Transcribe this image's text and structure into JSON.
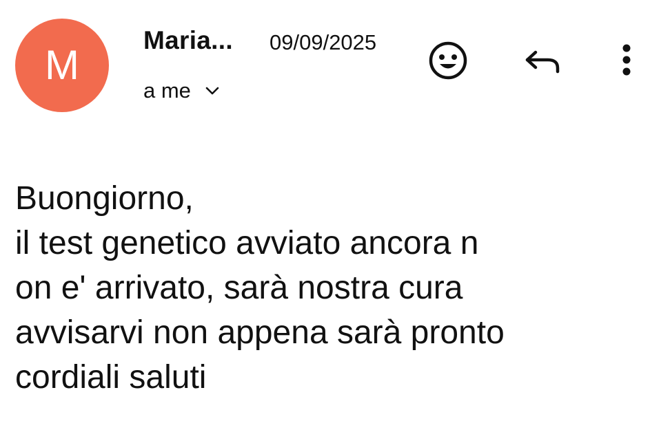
{
  "colors": {
    "avatar_bg": "#F26B4E",
    "text": "#111111",
    "icon": "#111111"
  },
  "header": {
    "avatar_initial": "M",
    "sender_name": "Maria...",
    "date": "09/09/2025",
    "recipient": "a me",
    "icons": {
      "expand_recipients": "chevron-down-icon",
      "emoji": "smiley-emoji-icon",
      "reply": "reply-arrow-icon",
      "more": "more-vertical-icon"
    }
  },
  "message": {
    "lines": [
      "Buongiorno,",
      "il test genetico avviato ancora n",
      "on e' arrivato, sarà nostra cura",
      "avvisarvi non appena sarà pronto",
      "cordiali saluti"
    ]
  }
}
